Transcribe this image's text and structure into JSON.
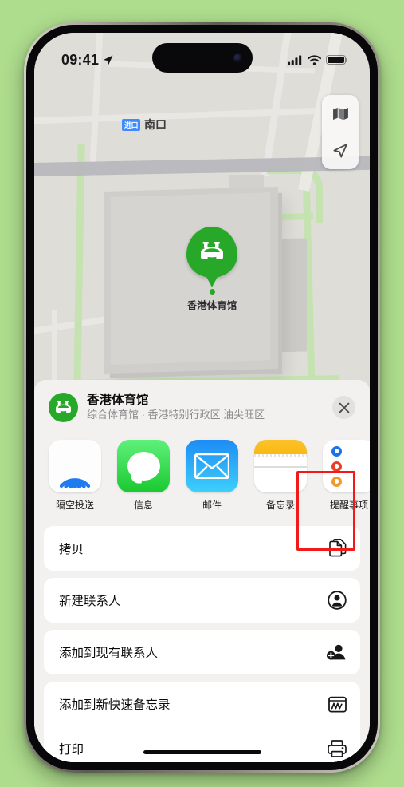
{
  "background_color": "#aedd8d",
  "status_bar": {
    "time": "09:41",
    "location_arrow_icon": "location-arrow-icon",
    "signal_icon": "cellular-signal-icon",
    "signal_bars": 4,
    "wifi_icon": "wifi-icon",
    "battery_icon": "battery-full-icon"
  },
  "map": {
    "poi_label": {
      "badge": "进口",
      "text": "南口"
    },
    "pin": {
      "icon": "stadium-icon",
      "caption": "香港体育馆",
      "color": "#28a828"
    },
    "controls": [
      {
        "name": "map-mode-button",
        "icon": "folded-map-icon"
      },
      {
        "name": "locate-me-button",
        "icon": "location-arrow-icon"
      }
    ]
  },
  "share_sheet": {
    "place": {
      "icon": "stadium-icon",
      "title": "香港体育馆",
      "subtitle": "综合体育馆 · 香港特别行政区 油尖旺区"
    },
    "close_icon": "close-icon",
    "apps": [
      {
        "id": "airdrop",
        "label": "隔空投送",
        "icon": "airdrop-icon",
        "highlighted": false
      },
      {
        "id": "messages",
        "label": "信息",
        "icon": "messages-icon",
        "highlighted": false
      },
      {
        "id": "mail",
        "label": "邮件",
        "icon": "mail-icon",
        "highlighted": false
      },
      {
        "id": "notes",
        "label": "备忘录",
        "icon": "notes-icon",
        "highlighted": true
      },
      {
        "id": "reminders",
        "label": "提醒事项",
        "icon": "reminders-icon",
        "highlighted": false
      }
    ],
    "highlight_color": "#f21a18",
    "actions": [
      {
        "label": "拷贝",
        "icon": "copy-icon"
      },
      {
        "label": "新建联系人",
        "icon": "new-contact-icon"
      },
      {
        "label": "添加到现有联系人",
        "icon": "add-to-contact-icon"
      },
      {
        "label": "添加到新快速备忘录",
        "icon": "quick-note-icon"
      },
      {
        "label": "打印",
        "icon": "printer-icon"
      }
    ]
  }
}
